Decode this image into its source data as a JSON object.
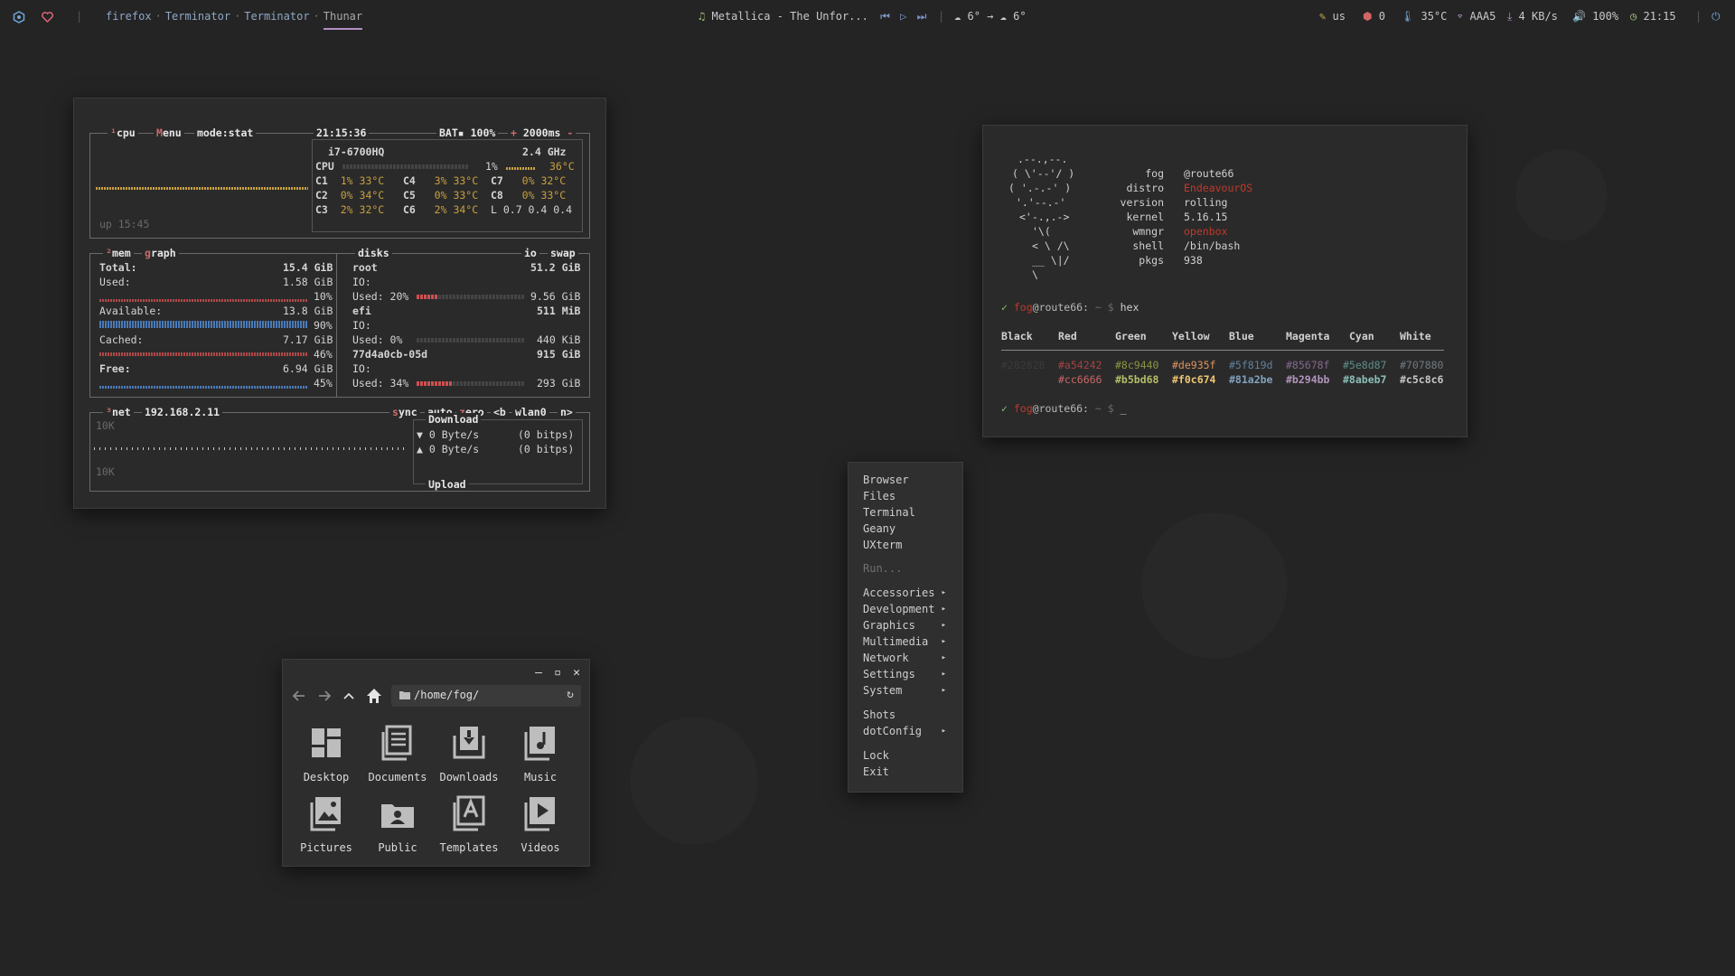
{
  "topbar": {
    "workspaces": [
      "firefox",
      "Terminator",
      "Terminator",
      "Thunar"
    ],
    "active_workspace": "Thunar",
    "music": "Metallica - The Unfor...",
    "weather_now": "6°",
    "weather_arrow": "→",
    "weather_later": "6°",
    "keyboard": "us",
    "updates": "0",
    "temp": "35°C",
    "wifi": "AAA5",
    "net_speed": "4 KB/s",
    "volume": "100%",
    "clock": "21:15"
  },
  "bpytop": {
    "cpu": {
      "label": "cpu",
      "menu": "Menu",
      "mode": "mode:stat",
      "time": "21:15:36",
      "bat": "BAT▪ 100%",
      "interval": "2000ms",
      "model": "i7-6700HQ",
      "freq": "2.4 GHz",
      "total_label": "CPU",
      "total_pct": "1%",
      "total_temp": "36°C",
      "cores": [
        [
          "C1",
          "1%",
          "33°C"
        ],
        [
          "C4",
          "3%",
          "33°C"
        ],
        [
          "C7",
          "0%",
          "32°C"
        ],
        [
          "C2",
          "0%",
          "34°C"
        ],
        [
          "C5",
          "0%",
          "33°C"
        ],
        [
          "C8",
          "0%",
          "33°C"
        ],
        [
          "C3",
          "2%",
          "32°C"
        ],
        [
          "C6",
          "2%",
          "34°C"
        ]
      ],
      "load": "L 0.7 0.4 0.4",
      "uptime": "up 15:45"
    },
    "mem": {
      "label": "mem",
      "graph": "graph",
      "total_label": "Total:",
      "total": "15.4 GiB",
      "used_label": "Used:",
      "used": "1.58 GiB",
      "used_pct": "10%",
      "avail_label": "Available:",
      "avail": "13.8 GiB",
      "avail_pct": "90%",
      "cached_label": "Cached:",
      "cached": "7.17 GiB",
      "cached_pct": "46%",
      "free_label": "Free:",
      "free": "6.94 GiB",
      "free_pct": "45%"
    },
    "disks": {
      "label": "disks",
      "io": "io",
      "swap": "swap",
      "root_label": "root",
      "root_size": "51.2 GiB",
      "io_label": "IO:",
      "root_used_label": "Used: 20%",
      "root_used": "9.56 GiB",
      "efi_label": "efi",
      "efi_size": "511 MiB",
      "efi_used_label": "Used:  0%",
      "efi_used": "440 KiB",
      "third_label": "77d4a0cb-05d",
      "third_size": "915 GiB",
      "third_used_label": "Used: 34%",
      "third_used": "293 GiB"
    },
    "net": {
      "label": "net",
      "ip": "192.168.2.11",
      "sync": "sync",
      "auto": "auto",
      "zero": "zero",
      "prev": "<b",
      "iface": "wlan0",
      "next": "n>",
      "download": "Download",
      "down_rate": "▼ 0 Byte/s",
      "down_bits": "(0 bitps)",
      "up_rate": "▲ 0 Byte/s",
      "up_bits": "(0 bitps)",
      "upload": "Upload",
      "scale_top": "10K",
      "scale_bottom": "10K"
    }
  },
  "neofetch": {
    "ascii": [
      "  .--.,--.",
      " ( \\'--'/ )",
      "( '.-.-' )",
      " '.'--.-'",
      "<'-.,.->",
      "  '\\(",
      " < \\ /\\",
      " __ \\|/",
      "    \\"
    ],
    "info": [
      [
        "fog",
        "@route66"
      ],
      [
        "distro",
        "EndeavourOS"
      ],
      [
        "version",
        "rolling"
      ],
      [
        "kernel",
        "5.16.15"
      ],
      [
        "wmngr",
        "openbox"
      ],
      [
        "shell",
        "/bin/bash"
      ],
      [
        "pkgs",
        "938"
      ]
    ],
    "prompt_check": "✓",
    "prompt_user": "fog",
    "prompt_host": "@route66:",
    "prompt_path": "~ $",
    "cmd": "hex",
    "cursor": "_",
    "colors_header": [
      "Black",
      "Red",
      "Green",
      "Yellow",
      "Blue",
      "Magenta",
      "Cyan",
      "White"
    ],
    "colors_normal": [
      "#282828",
      "#a54242",
      "#8c9440",
      "#de935f",
      "#5f819d",
      "#85678f",
      "#5e8d87",
      "#707880"
    ],
    "colors_bright": [
      "#cc6666",
      "#b5bd68",
      "#f0c674",
      "#81a2be",
      "#b294bb",
      "#8abeb7",
      "#c5c8c6"
    ]
  },
  "menu": {
    "items": [
      {
        "label": "Browser",
        "sub": false
      },
      {
        "label": "Files",
        "sub": false
      },
      {
        "label": "Terminal",
        "sub": false
      },
      {
        "label": "Geany",
        "sub": false
      },
      {
        "label": "UXterm",
        "sub": false
      },
      {
        "label": "Run...",
        "sub": false,
        "disabled": true
      },
      {
        "label": "Accessories",
        "sub": true
      },
      {
        "label": "Development",
        "sub": true
      },
      {
        "label": "Graphics",
        "sub": true
      },
      {
        "label": "Multimedia",
        "sub": true
      },
      {
        "label": "Network",
        "sub": true
      },
      {
        "label": "Settings",
        "sub": true
      },
      {
        "label": "System",
        "sub": true
      },
      {
        "label": "Shots",
        "sub": false
      },
      {
        "label": "dotConfig",
        "sub": true
      },
      {
        "label": "Lock",
        "sub": false
      },
      {
        "label": "Exit",
        "sub": false
      }
    ],
    "arrow": "▸"
  },
  "thunar": {
    "path": "/home/fog/",
    "folders": [
      "Desktop",
      "Documents",
      "Downloads",
      "Music",
      "Pictures",
      "Public",
      "Templates",
      "Videos"
    ],
    "min": "–",
    "max": "▫",
    "close": "✕"
  }
}
